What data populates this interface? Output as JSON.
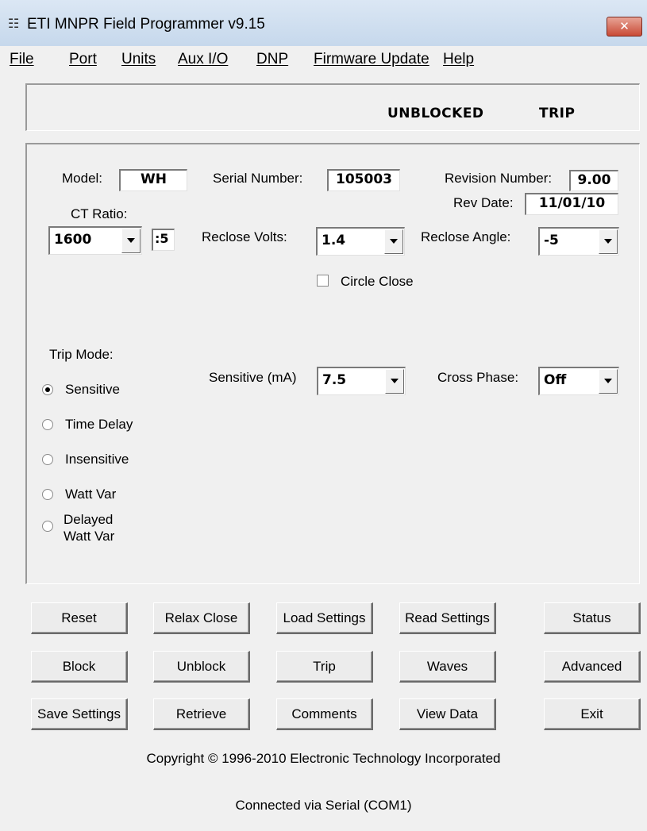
{
  "window": {
    "title": "ETI MNPR Field Programmer v9.15",
    "close_label": "✕",
    "app_icon": "app-icon"
  },
  "menu": [
    "File",
    "Port",
    "Units",
    "Aux I/O",
    "DNP",
    "Firmware Update",
    "Help"
  ],
  "status": {
    "block_state": "UNBLOCKED",
    "trip_state": "TRIP"
  },
  "settings": {
    "model_label": "Model:",
    "model_value": "WH",
    "serial_label": "Serial Number:",
    "serial_value": "105003",
    "revision_label": "Revision Number:",
    "revision_value": "9.00",
    "rev_date_label": "Rev Date:",
    "rev_date_value": "11/01/10",
    "ct_ratio_label": "CT Ratio:",
    "ct_ratio_value": "1600",
    "ct_ratio_suffix": ":5",
    "reclose_volts_label": "Reclose Volts:",
    "reclose_volts_value": "1.4",
    "reclose_angle_label": "Reclose Angle:",
    "reclose_angle_value": "-5",
    "circle_close_label": "Circle Close",
    "circle_close_checked": false,
    "trip_mode_label": "Trip Mode:",
    "trip_modes": [
      "Sensitive",
      "Time Delay",
      "Insensitive",
      "Watt Var",
      "Delayed",
      "Watt Var"
    ],
    "trip_mode_selected": "Sensitive",
    "sensitive_label": "Sensitive (mA)",
    "sensitive_value": "7.5",
    "cross_phase_label": "Cross Phase:",
    "cross_phase_value": "Off"
  },
  "buttons": {
    "row1": [
      "Reset",
      "Relax Close",
      "Load Settings",
      "Read Settings",
      "Status"
    ],
    "row2": [
      "Block",
      "Unblock",
      "Trip",
      "Waves",
      "Advanced"
    ],
    "row3": [
      "Save Settings",
      "Retrieve",
      "Comments",
      "View Data",
      "Exit"
    ]
  },
  "footer": {
    "copyright": "Copyright © 1996-2010 Electronic Technology Incorporated",
    "connection": "Connected via Serial (COM1)"
  }
}
